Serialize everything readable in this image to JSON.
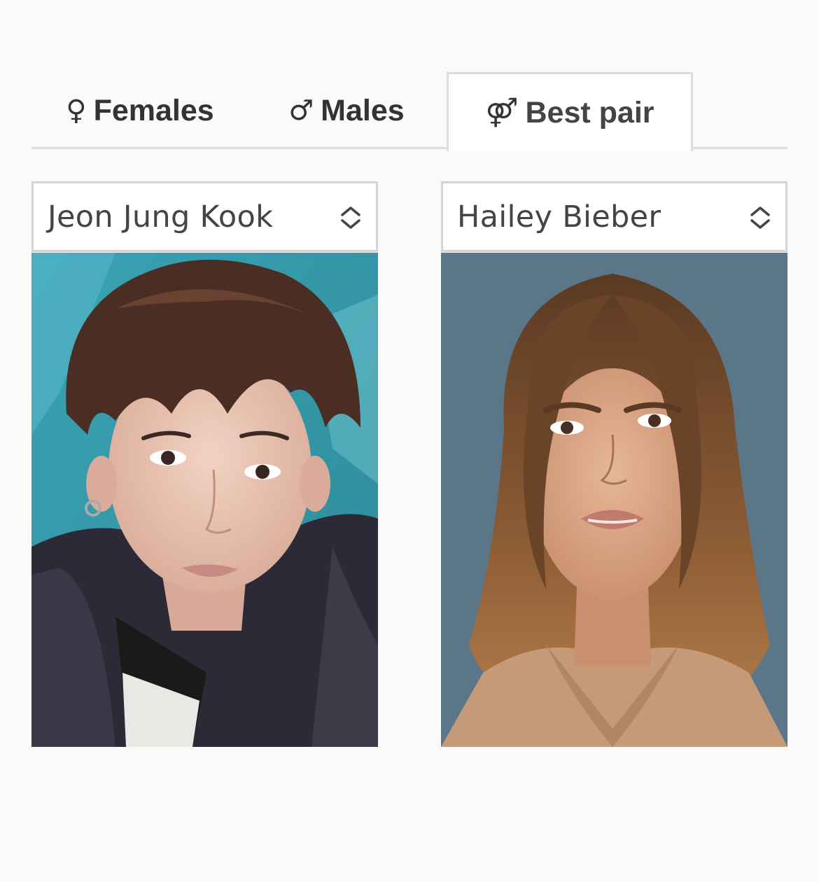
{
  "tabs": [
    {
      "icon": "female-icon",
      "symbol": "♀",
      "label": "Females",
      "active": false
    },
    {
      "icon": "male-icon",
      "symbol": "♂",
      "label": "Males",
      "active": false
    },
    {
      "icon": "pair-icon",
      "symbol": "⚤",
      "label": "Best pair",
      "active": true
    }
  ],
  "selects": {
    "left": {
      "value": "Jeon Jung Kook"
    },
    "right": {
      "value": "Hailey Bieber"
    }
  },
  "photos": {
    "left": {
      "icon": "portrait-photo",
      "background": "#3da3b4"
    },
    "right": {
      "icon": "portrait-photo",
      "background": "#5a7688"
    }
  },
  "colors": {
    "page_bg": "#fafafa",
    "border": "#dddddd",
    "text": "#333333"
  }
}
